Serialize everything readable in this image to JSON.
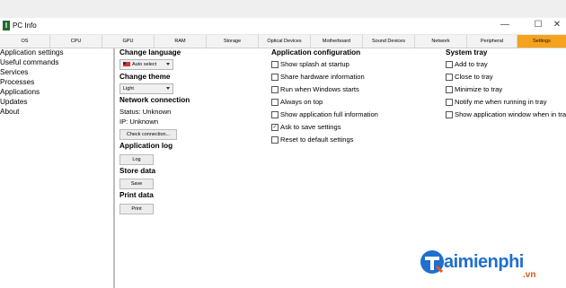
{
  "window": {
    "title": "PC Info",
    "icon_letter": "I",
    "controls": [
      "—",
      "☐",
      "✕"
    ]
  },
  "tabs": [
    "OS",
    "CPU",
    "GPU",
    "RAM",
    "Storage",
    "Optical Devices",
    "Motherboard",
    "Sound Devices",
    "Network",
    "Peripheral",
    "Settings"
  ],
  "active_tab": "Settings",
  "sidebar": {
    "items": [
      "Application settings",
      "Useful commands",
      "Services",
      "Processes",
      "Applications",
      "Updates",
      "About"
    ]
  },
  "settings": {
    "change_language": {
      "title": "Change language",
      "value": "Auto select"
    },
    "change_theme": {
      "title": "Change theme",
      "value": "Light"
    },
    "network_connection": {
      "title": "Network connection",
      "status": "Status:  Unknown",
      "ip": "IP:  Unknown",
      "check_button": "Check connection..."
    },
    "application_log": {
      "title": "Application log",
      "button": "Log"
    },
    "store_data": {
      "title": "Store data",
      "button": "Save"
    },
    "print_data": {
      "title": "Print data",
      "button": "Print"
    }
  },
  "app_config": {
    "title": "Application configuration",
    "options": [
      {
        "label": "Show splash at startup",
        "checked": false
      },
      {
        "label": "Share hardware information",
        "checked": false
      },
      {
        "label": "Run when Windows starts",
        "checked": false
      },
      {
        "label": "Always on top",
        "checked": false
      },
      {
        "label": "Show application full information",
        "checked": false
      },
      {
        "label": "Ask to save settings",
        "checked": true
      },
      {
        "label": "Reset to default settings",
        "checked": false
      }
    ]
  },
  "system_tray": {
    "title": "System tray",
    "options": [
      {
        "label": "Add to tray",
        "checked": false
      },
      {
        "label": "Close to tray",
        "checked": false
      },
      {
        "label": "Minimize to tray",
        "checked": false
      },
      {
        "label": "Notify me when running in tray",
        "checked": false
      },
      {
        "label": "Show application window when in tray",
        "checked": false
      }
    ]
  },
  "watermark": {
    "brand": "aimienphi",
    "suffix": ".vn"
  },
  "colors": {
    "active_tab": "#f6a21c",
    "watermark_blue": "#1f6fcf",
    "watermark_orange": "#e05a1c"
  }
}
